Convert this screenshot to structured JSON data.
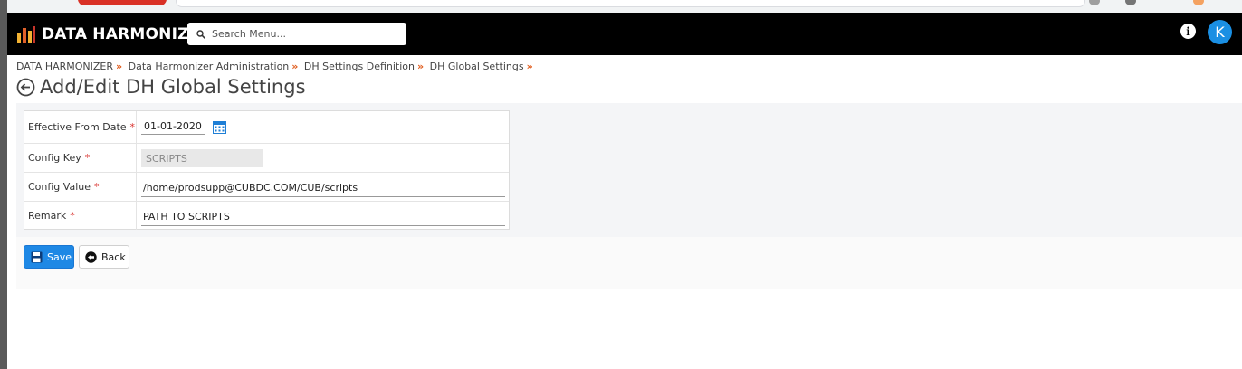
{
  "app": {
    "brand": "DATA HARMONIZER",
    "search_placeholder": "Search Menu...",
    "info_icon": "info-icon",
    "avatar_initial": "K",
    "colors": {
      "topbar": "#000000",
      "accent": "#1e88e5",
      "required": "#d9302c",
      "breadcrumb_separator": "#e05a1a"
    }
  },
  "breadcrumb": {
    "items": [
      "DATA HARMONIZER",
      "Data Harmonizer Administration",
      "DH Settings Definition",
      "DH Global Settings"
    ],
    "separator": "»"
  },
  "page": {
    "title": "Add/Edit DH Global Settings"
  },
  "form": {
    "effective_from_date": {
      "label": "Effective From Date",
      "value": "01-01-2020"
    },
    "config_key": {
      "label": "Config Key",
      "value": "SCRIPTS"
    },
    "config_value": {
      "label": "Config Value",
      "value": "/home/prodsupp@CUBDC.COM/CUB/scripts"
    },
    "remark": {
      "label": "Remark",
      "value": "PATH TO SCRIPTS"
    },
    "required_marker": "*"
  },
  "actions": {
    "save_label": "Save",
    "back_label": "Back"
  }
}
